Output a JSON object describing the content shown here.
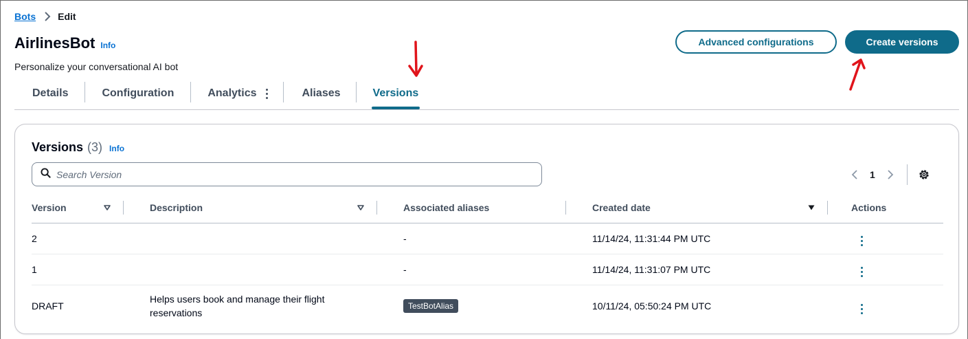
{
  "breadcrumb": {
    "parent": "Bots",
    "current": "Edit"
  },
  "page": {
    "title": "AirlinesBot",
    "info": "Info",
    "subtitle": "Personalize your conversational AI bot"
  },
  "header_actions": {
    "advanced": "Advanced configurations",
    "create": "Create versions"
  },
  "tabs": [
    {
      "label": "Details",
      "active": false
    },
    {
      "label": "Configuration",
      "active": false
    },
    {
      "label": "Analytics",
      "active": false
    },
    {
      "label": "Aliases",
      "active": false
    },
    {
      "label": "Versions",
      "active": true
    }
  ],
  "versions_card": {
    "title": "Versions",
    "count": "(3)",
    "info": "Info",
    "search_placeholder": "Search Version",
    "page": "1"
  },
  "table": {
    "columns": [
      "Version",
      "Description",
      "Associated aliases",
      "Created date",
      "Actions"
    ],
    "rows": [
      {
        "version": "2",
        "description": "",
        "aliases": "-",
        "created": "11/14/24, 11:31:44 PM UTC"
      },
      {
        "version": "1",
        "description": "",
        "aliases": "-",
        "created": "11/14/24, 11:31:07 PM UTC"
      },
      {
        "version": "DRAFT",
        "description_line1": "Helps users book and manage their flight",
        "description_line2": "reservations",
        "alias_badge": "TestBotAlias",
        "created": "10/11/24, 05:50:24 PM UTC"
      }
    ]
  },
  "colors": {
    "accent": "#0f6b8a",
    "link": "#0972d3",
    "annotation_arrow": "#e0141b"
  }
}
